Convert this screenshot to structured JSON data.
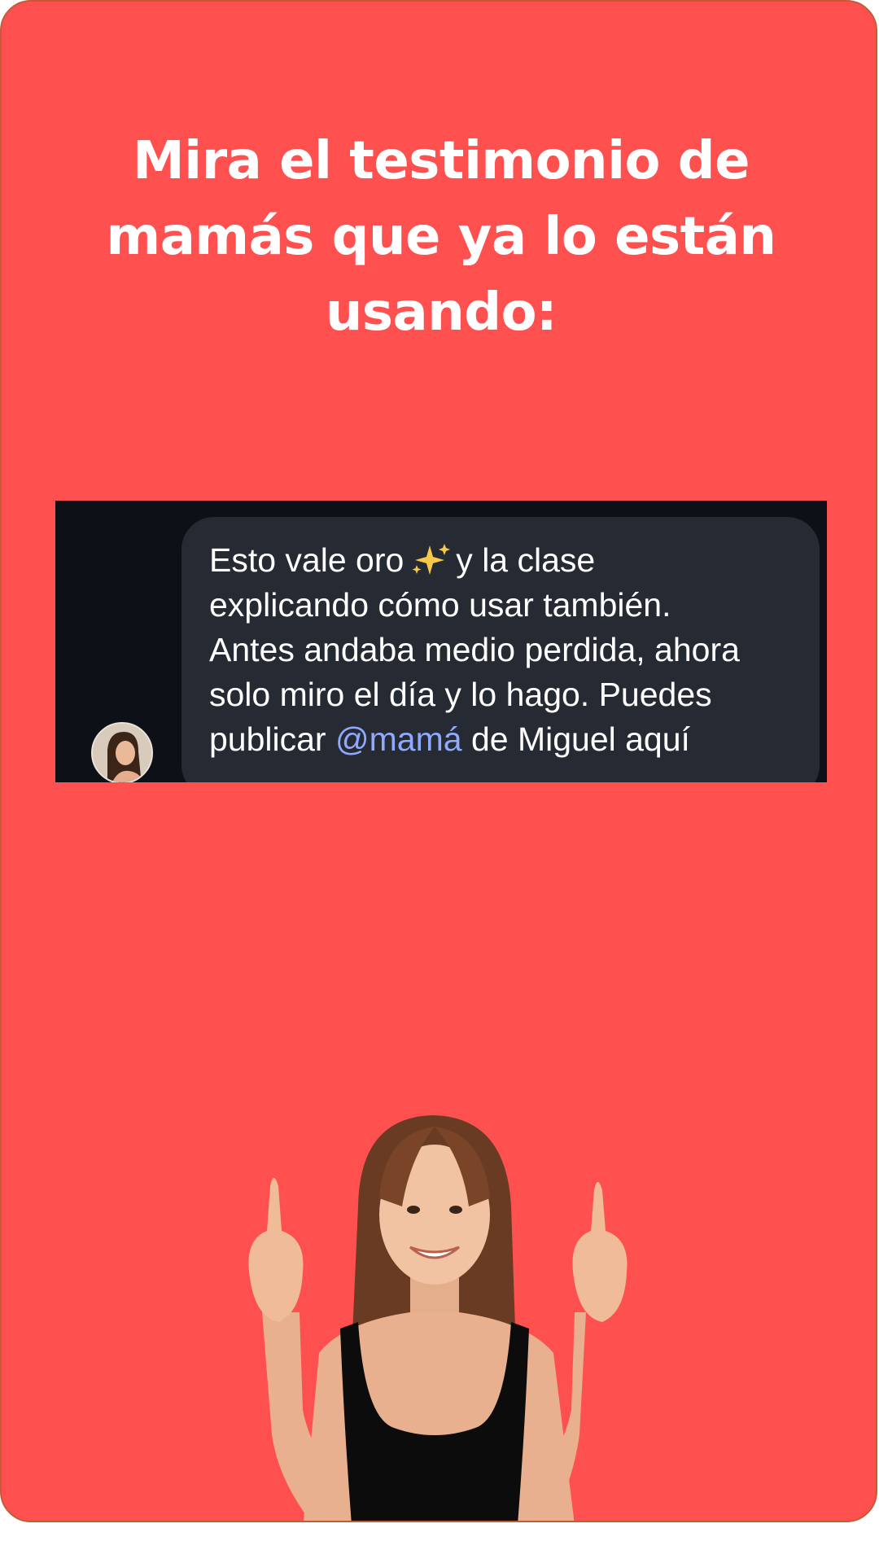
{
  "page": {
    "headline_lines": [
      "Mira el testimonio de",
      "mamás que ya lo están",
      "usando:"
    ]
  },
  "testimonial": {
    "line1_before_icon": "Esto vale oro",
    "icon": "sparkles-icon",
    "line1_after_icon": "y la clase",
    "line2": "explicando cómo usar también.",
    "line3": "Antes andaba medio perdida, ahora",
    "line4": "solo miro el día y lo hago. Puedes",
    "line5_before_mention": "publicar",
    "mention": "@mamá",
    "line5_after_mention": "de Miguel aquí"
  },
  "colors": {
    "background": "#ff5050",
    "chat_background": "#0d1117",
    "bubble": "#262a33",
    "mention": "#8fa9ff",
    "text": "#ffffff"
  }
}
